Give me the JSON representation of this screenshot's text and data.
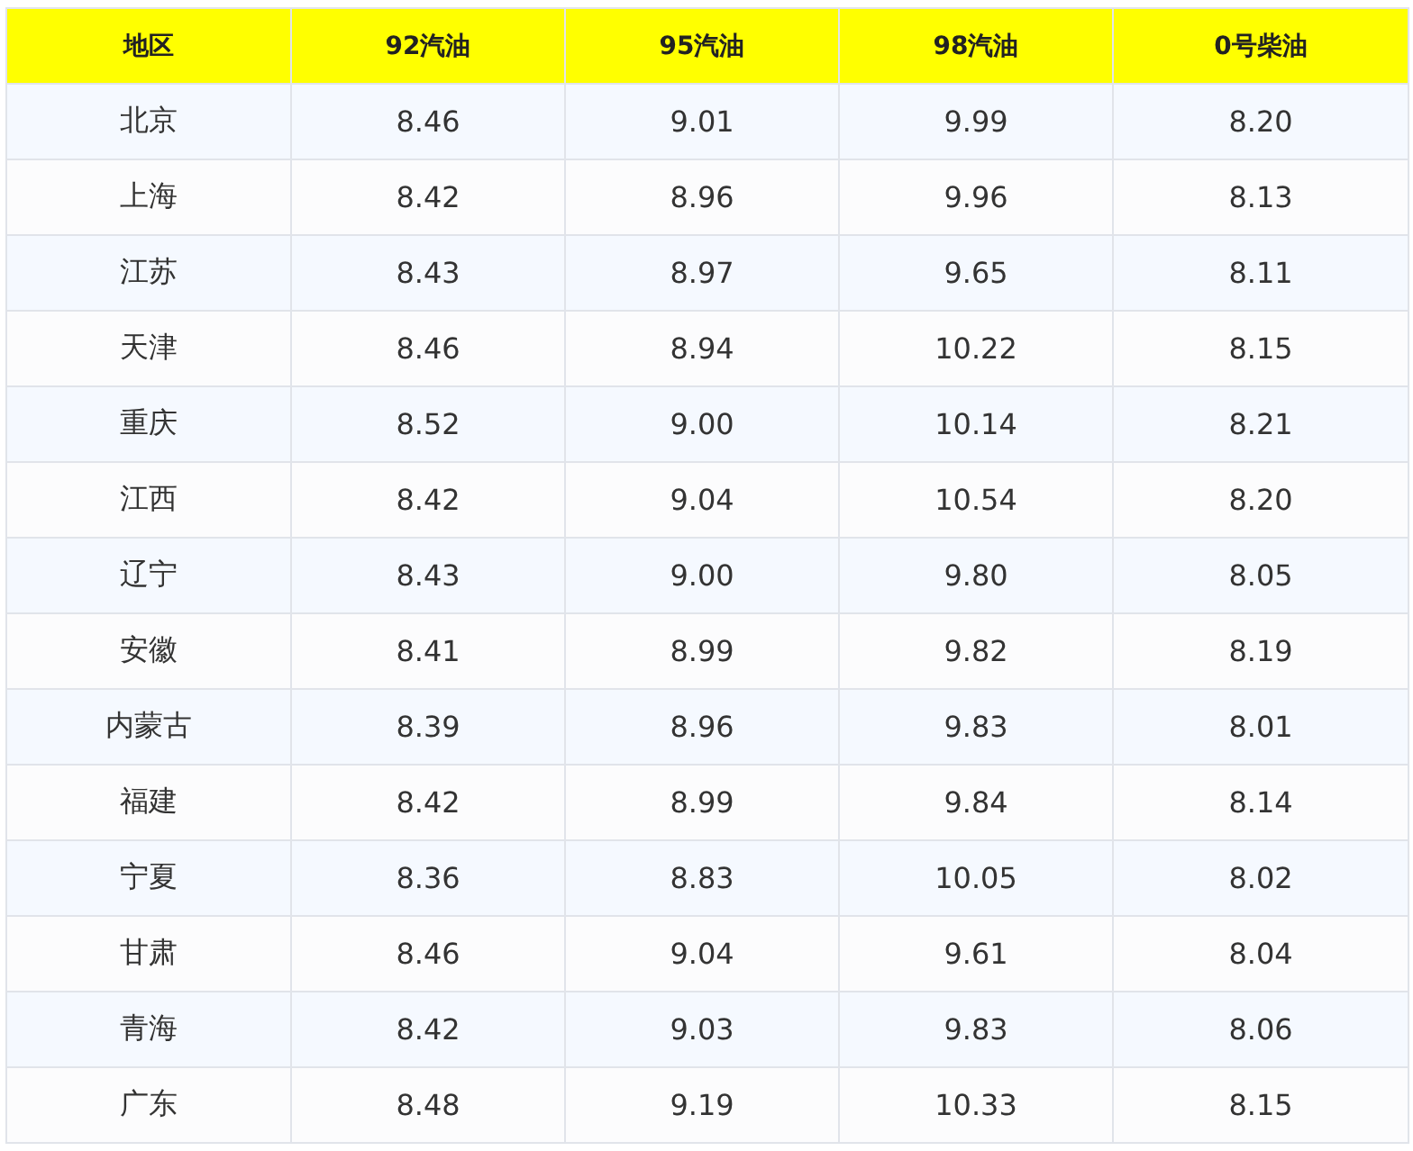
{
  "table": {
    "columns": [
      "地区",
      "92汽油",
      "95汽油",
      "98汽油",
      "0号柴油"
    ],
    "rows": [
      [
        "北京",
        "8.46",
        "9.01",
        "9.99",
        "8.20"
      ],
      [
        "上海",
        "8.42",
        "8.96",
        "9.96",
        "8.13"
      ],
      [
        "江苏",
        "8.43",
        "8.97",
        "9.65",
        "8.11"
      ],
      [
        "天津",
        "8.46",
        "8.94",
        "10.22",
        "8.15"
      ],
      [
        "重庆",
        "8.52",
        "9.00",
        "10.14",
        "8.21"
      ],
      [
        "江西",
        "8.42",
        "9.04",
        "10.54",
        "8.20"
      ],
      [
        "辽宁",
        "8.43",
        "9.00",
        "9.80",
        "8.05"
      ],
      [
        "安徽",
        "8.41",
        "8.99",
        "9.82",
        "8.19"
      ],
      [
        "内蒙古",
        "8.39",
        "8.96",
        "9.83",
        "8.01"
      ],
      [
        "福建",
        "8.42",
        "8.99",
        "9.84",
        "8.14"
      ],
      [
        "宁夏",
        "8.36",
        "8.83",
        "10.05",
        "8.02"
      ],
      [
        "甘肃",
        "8.46",
        "9.04",
        "9.61",
        "8.04"
      ],
      [
        "青海",
        "8.42",
        "9.03",
        "9.83",
        "8.06"
      ],
      [
        "广东",
        "8.48",
        "9.19",
        "10.33",
        "8.15"
      ]
    ]
  }
}
